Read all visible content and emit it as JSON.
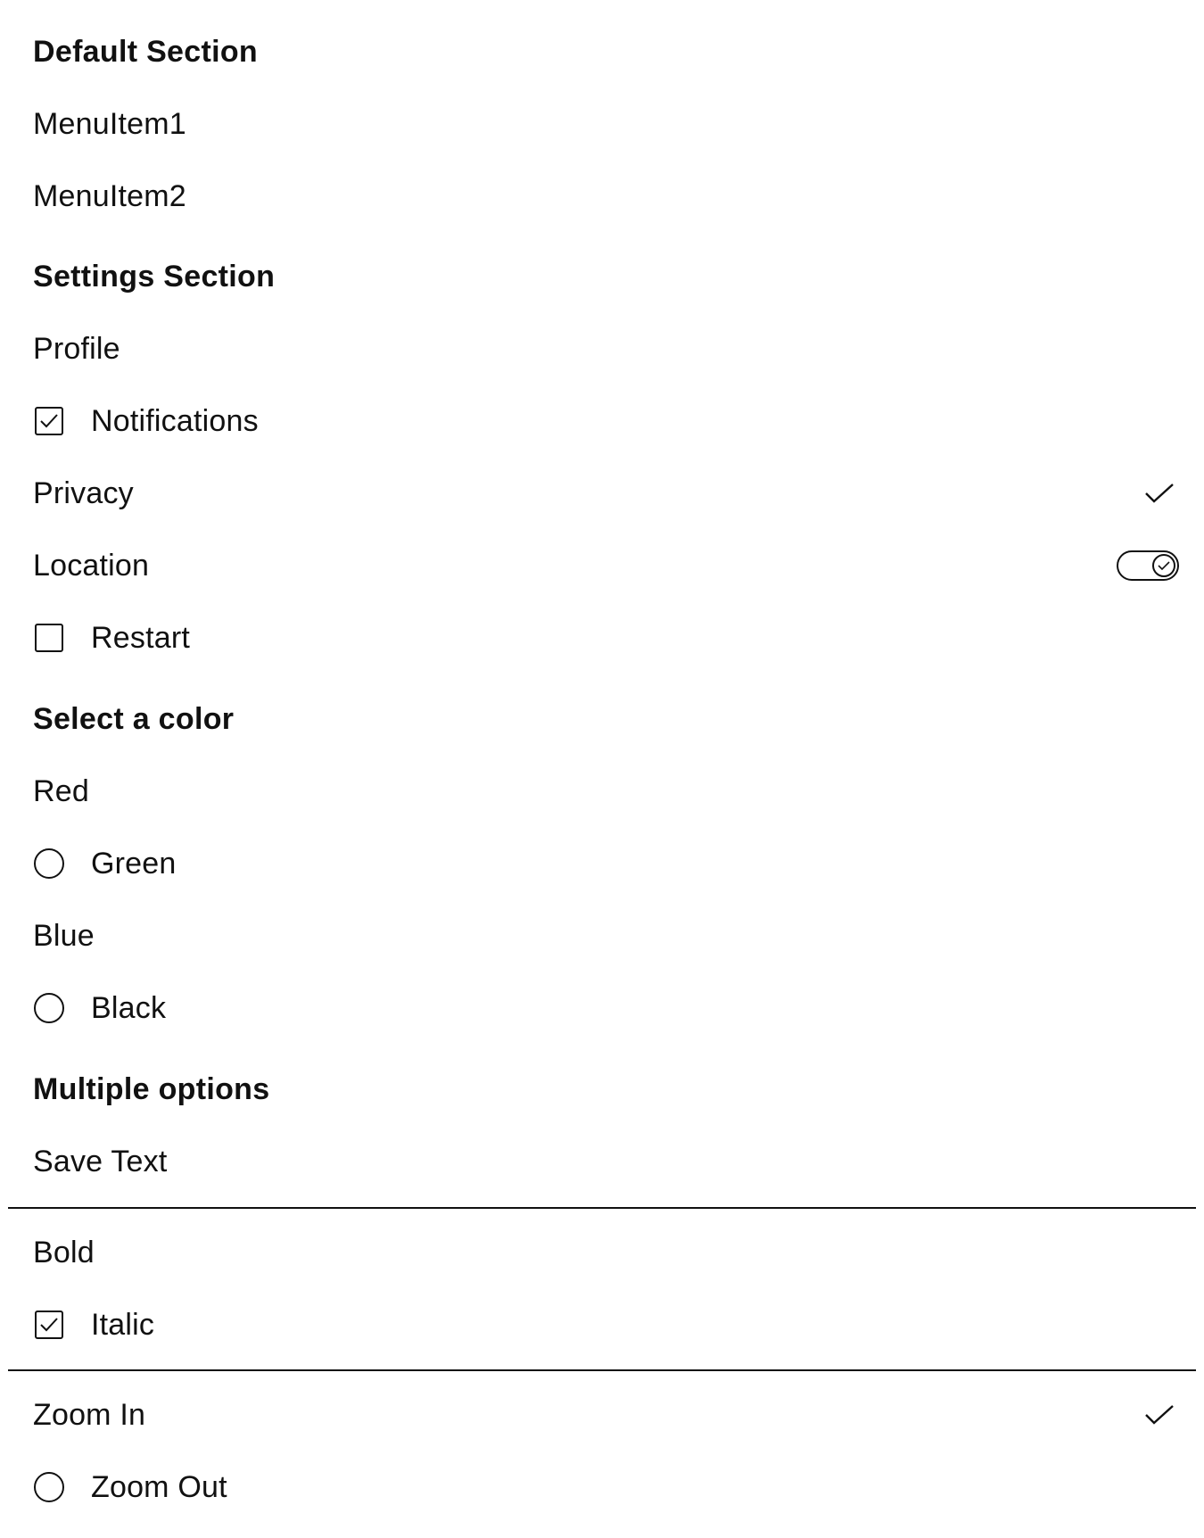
{
  "sections": {
    "default": {
      "title": "Default Section",
      "items": [
        "MenuItem1",
        "MenuItem2"
      ]
    },
    "settings": {
      "title": "Settings Section",
      "profile": "Profile",
      "notifications": {
        "label": "Notifications",
        "checked": true
      },
      "privacy": {
        "label": "Privacy",
        "checked": true
      },
      "location": {
        "label": "Location",
        "toggle_on": true
      },
      "restart": {
        "label": "Restart",
        "checked": false
      }
    },
    "color": {
      "title": "Select a color",
      "red": "Red",
      "green": {
        "label": "Green",
        "selected": false
      },
      "blue": "Blue",
      "black": {
        "label": "Black",
        "selected": false
      }
    },
    "multiple": {
      "title": "Multiple options",
      "save_text": "Save Text",
      "bold": "Bold",
      "italic": {
        "label": "Italic",
        "checked": true
      },
      "zoom_in": {
        "label": "Zoom In",
        "checked": true
      },
      "zoom_out": {
        "label": "Zoom Out",
        "selected": false
      }
    }
  },
  "icons": {
    "checkmark": "check-icon",
    "checkbox": "checkbox-icon",
    "radio": "radio-icon",
    "toggle": "toggle-icon"
  },
  "colors": {
    "text": "#111111",
    "background": "#ffffff"
  }
}
